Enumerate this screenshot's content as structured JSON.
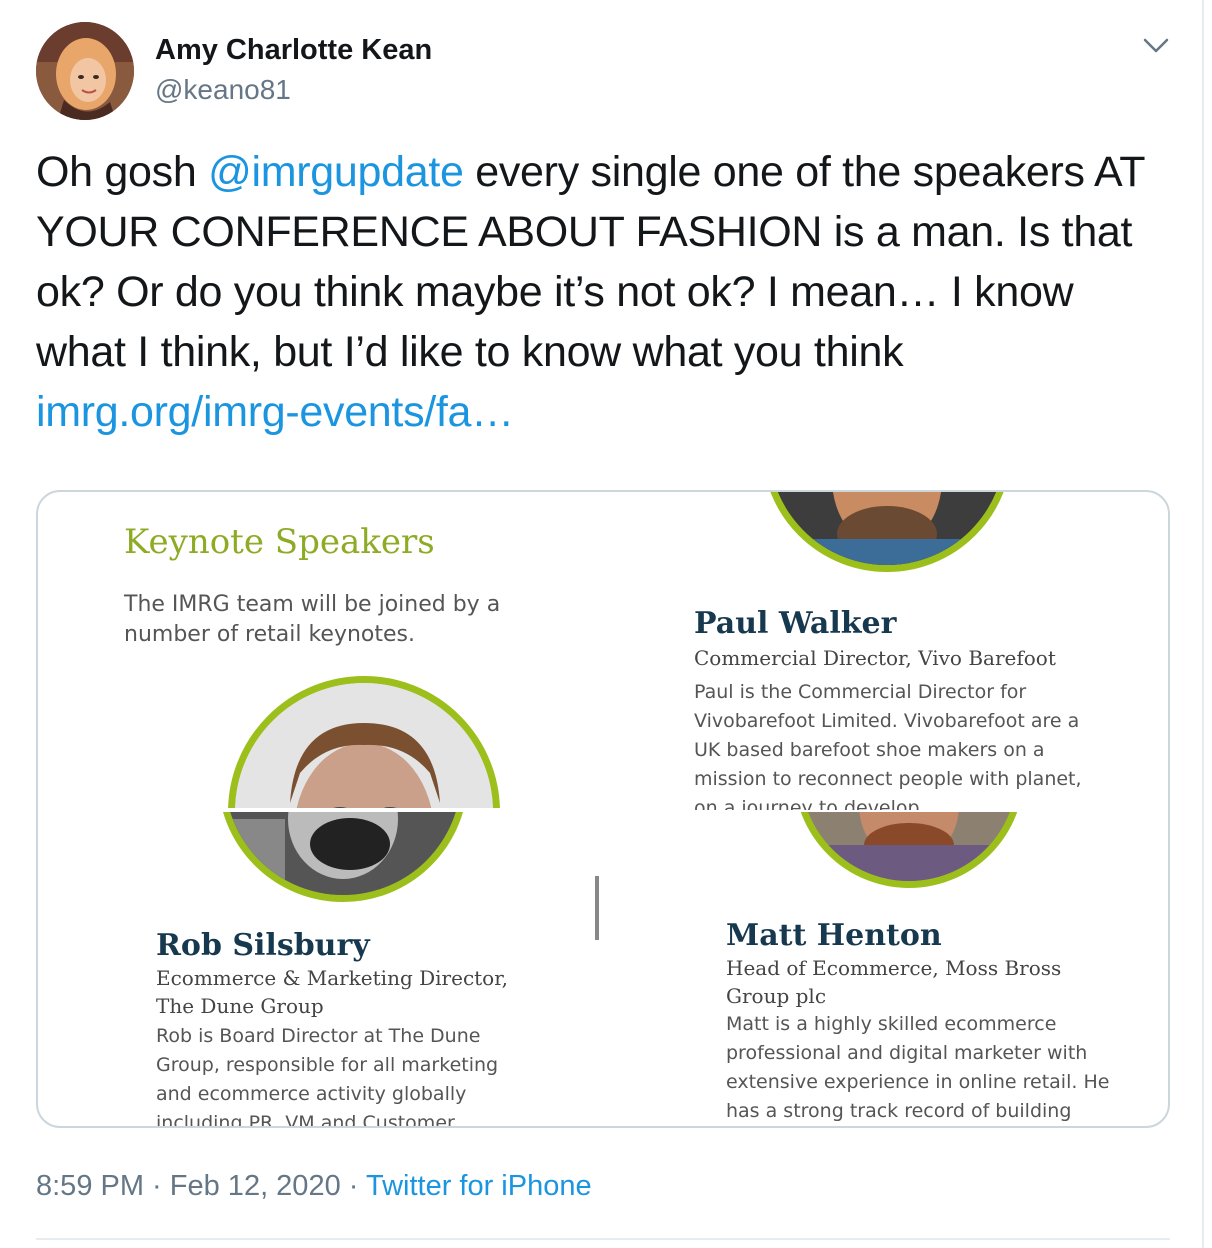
{
  "tweet": {
    "author": {
      "name": "Amy Charlotte Kean",
      "handle": "@keano81"
    },
    "text": {
      "part1": "Oh gosh ",
      "mention": "@imrgupdate",
      "part2": " every single one of the speakers AT YOUR CONFERENCE ABOUT FASHION is a man. Is that ok? Or do you think maybe it’s not ok? I mean… I know what I think, but I’d like to know what you think",
      "link": "imrg.org/imrg-events/fa…"
    },
    "timestamp": {
      "time": "8:59 PM",
      "sep1": " · ",
      "date": "Feb 12, 2020",
      "sep2": " · ",
      "source": "Twitter for iPhone"
    }
  },
  "media": {
    "heading": "Keynote Speakers",
    "intro": "The IMRG team will be joined by a number of retail keynotes.",
    "speakers": [
      {
        "name": "Paul Walker",
        "role": "Commercial Director, Vivo Barefoot",
        "bio": "Paul is the Commercial Director for Vivobarefoot Limited. Vivobarefoot are a UK based barefoot shoe makers on a mission to reconnect people with planet, on a journey to develop"
      },
      {
        "name": "Rob Silsbury",
        "role": "Ecommerce & Marketing Director, The Dune Group",
        "bio": "Rob is Board Director at The Dune Group, responsible for all marketing and ecommerce activity globally including PR, VM and Customer"
      },
      {
        "name": "Matt Henton",
        "role": "Head of Ecommerce, Moss Bross Group plc",
        "bio": "Matt is a highly skilled ecommerce professional and digital marketer with extensive experience in online retail. He has a strong track record of building"
      }
    ],
    "accent_color": "#9cbf1c",
    "name_color": "#17394f"
  },
  "icons": {
    "caret": "chevron-down-icon"
  },
  "colors": {
    "link": "#1b95e0",
    "secondary": "#657786"
  }
}
